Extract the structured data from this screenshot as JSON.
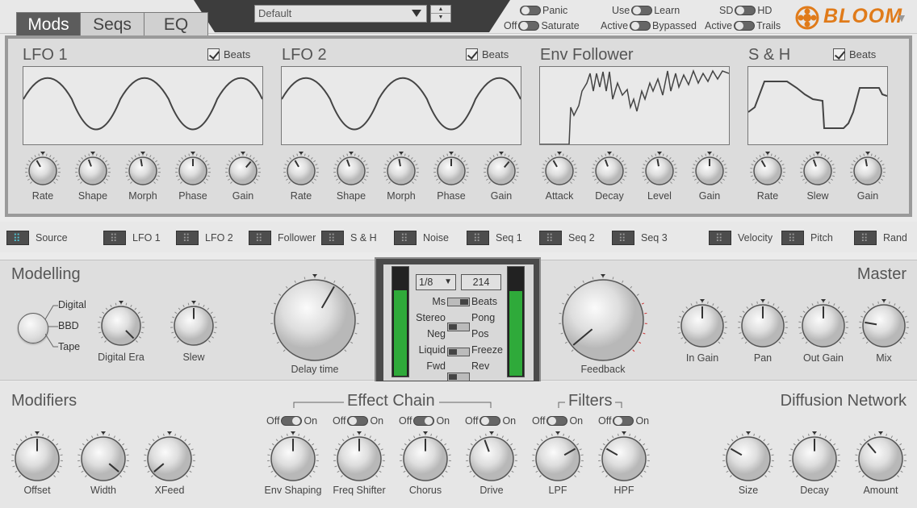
{
  "tabs": [
    "Mods",
    "Seqs",
    "EQ"
  ],
  "preset": {
    "name": "Default"
  },
  "toggles": {
    "panic": "Panic",
    "off1": "Off",
    "saturate": "Saturate",
    "use": "Use",
    "learn": "Learn",
    "active1": "Active",
    "bypassed": "Bypassed",
    "sd": "SD",
    "hd": "HD",
    "active2": "Active",
    "trails": "Trails"
  },
  "logo": "BLOOM",
  "mods": {
    "lfo1": {
      "title": "LFO 1",
      "beats": "Beats",
      "knobs": [
        "Rate",
        "Shape",
        "Morph",
        "Phase",
        "Gain"
      ]
    },
    "lfo2": {
      "title": "LFO 2",
      "beats": "Beats",
      "knobs": [
        "Rate",
        "Shape",
        "Morph",
        "Phase",
        "Gain"
      ]
    },
    "env": {
      "title": "Env Follower",
      "knobs": [
        "Attack",
        "Decay",
        "Level",
        "Gain"
      ]
    },
    "sh": {
      "title": "S & H",
      "beats": "Beats",
      "knobs": [
        "Rate",
        "Slew",
        "Gain"
      ]
    }
  },
  "sources": [
    "Source",
    "LFO 1",
    "LFO 2",
    "Follower",
    "S & H",
    "Noise",
    "Seq 1",
    "Seq 2",
    "Seq 3",
    "Velocity",
    "Pitch",
    "Rand"
  ],
  "modelling": {
    "title": "Modelling",
    "modes": [
      "Digital",
      "BBD",
      "Tape"
    ],
    "knobs": [
      "Digital Era",
      "Slew"
    ]
  },
  "delay": {
    "label": "Delay time",
    "division": "1/8",
    "bpm": "214",
    "pairs": [
      [
        "Ms",
        "Beats"
      ],
      [
        "Stereo",
        "Pong"
      ],
      [
        "Neg",
        "Pos"
      ],
      [
        "Liquid",
        "Freeze"
      ],
      [
        "Fwd",
        "Rev"
      ]
    ],
    "left_meter": 0.79,
    "right_meter": 0.78
  },
  "feedback": "Feedback",
  "master": {
    "title": "Master",
    "knobs": [
      "In Gain",
      "Pan",
      "Out Gain",
      "Mix"
    ]
  },
  "modifiers": {
    "title": "Modifiers",
    "knobs": [
      "Offset",
      "Width",
      "XFeed"
    ]
  },
  "effect_chain": {
    "title": "Effect Chain",
    "knobs": [
      "Env Shaping",
      "Freq Shifter",
      "Chorus",
      "Drive"
    ]
  },
  "filters": {
    "title": "Filters",
    "knobs": [
      "LPF",
      "HPF"
    ]
  },
  "diffusion": {
    "title": "Diffusion Network",
    "knobs": [
      "Size",
      "Decay",
      "Amount"
    ]
  },
  "onoff": {
    "off": "Off",
    "on": "On"
  },
  "colors": {
    "accent": "#e07b1a",
    "meter": "#2faa3a",
    "source_active": "#4fc8d8",
    "feedback_arc": "#cc3333"
  }
}
